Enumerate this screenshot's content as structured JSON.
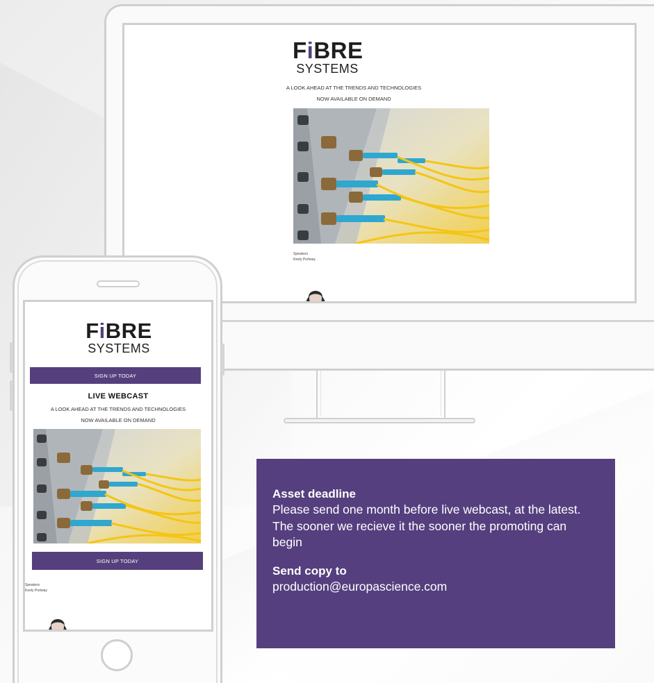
{
  "monitor_email": {
    "logo": {
      "line1": "FiBRE",
      "line2": "SYSTEMS"
    },
    "tagline": "A LOOK AHEAD AT THE TRENDS AND TECHNOLOGIES",
    "availability": "NOW AVAILABLE ON DEMAND",
    "speakers_label": "Speakers",
    "speaker_name": "Keely Portway"
  },
  "phone_email": {
    "logo": {
      "line1": "FiBRE",
      "line2": "SYSTEMS"
    },
    "signup_top": "SIGN UP TODAY",
    "heading": "LIVE WEBCAST",
    "tagline": "A LOOK AHEAD AT THE TRENDS AND TECHNOLOGIES",
    "availability": "NOW AVAILABLE ON DEMAND",
    "signup_bottom": "SIGN UP TODAY",
    "speakers_label": "Speakers",
    "speaker_name": "Keely Portway"
  },
  "info_box": {
    "deadline_heading": "Asset deadline",
    "deadline_text": "Please send one month before live webcast, at the latest. The sooner we recieve it the sooner the promoting can begin",
    "copy_heading": "Send copy to",
    "copy_email": "production@europascience.com"
  },
  "colors": {
    "brand_purple": "#553f7e",
    "device_outline": "#cfcfcf"
  },
  "icons": [
    "fibre-optic-photo",
    "speaker-avatar",
    "home-button-icon",
    "earpiece-speaker-icon"
  ]
}
